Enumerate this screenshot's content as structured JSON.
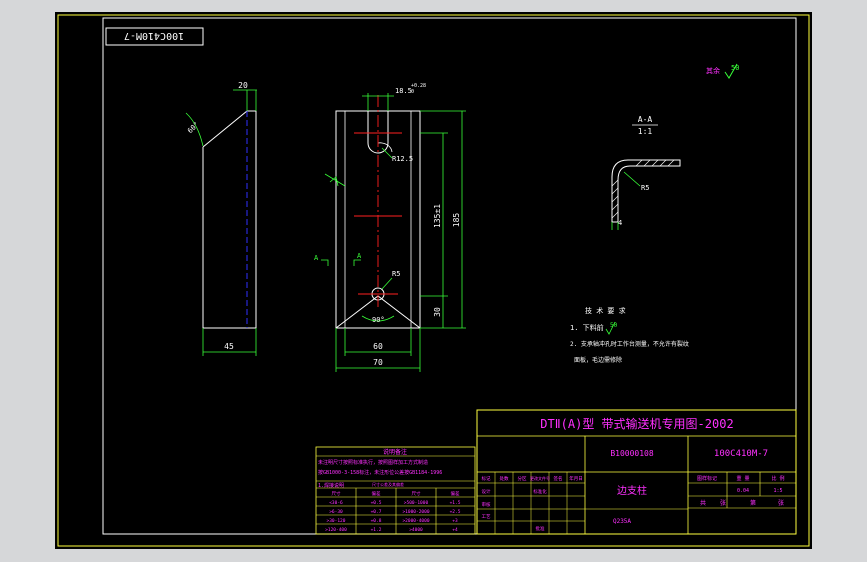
{
  "drawing": {
    "stamp_number": "100C410M-7",
    "roughness_note": "其余",
    "roughness_value": "50",
    "section_label": "A-A",
    "section_ratio": "1:1",
    "section_radius": "R5",
    "section_thickness": "4",
    "section_mark_left": "A",
    "section_mark_right": "A",
    "dim_top_width": "18.5",
    "dim_top_tol": "+0.28",
    "dim_top_tol_low": "0",
    "dim_side_width": "20",
    "dim_angle_side": "60°",
    "dim_r12": "R12.5",
    "dim_r5": "R5",
    "dim_135": "135±1",
    "dim_185": "185",
    "dim_30": "30",
    "dim_angle_90": "90°",
    "dim_60": "60",
    "dim_70": "70",
    "dim_45": "45",
    "tech_title": "技 术 要 求",
    "tech_line1": "1. 下料前",
    "tech_line1_val": "50",
    "tech_line2": "2. 支承轴冲孔时工作台测量，不允许有裂纹",
    "tech_line3": "面板，毛边需修除"
  },
  "title_block": {
    "main_title": "DTⅡ(A)型  带式输送机专用图-2002",
    "code_left": "B10000108",
    "code_right": "100C410M-7",
    "part_name": "边支柱",
    "material": "Q235A",
    "stage_label": "图样标记",
    "weight_label": "重 量",
    "scale_label": "比 例",
    "weight_val": "0.04",
    "scale_val": "1:5",
    "sheet_label": "共",
    "sheet_of": "张",
    "sheet_no": "第",
    "sheet_no2": "张",
    "rev_headers": [
      "标记",
      "处数",
      "分区",
      "更改文件号",
      "签名",
      "年月日"
    ],
    "design_row": [
      "设计",
      "",
      "",
      "标准化",
      "",
      ""
    ],
    "check_row": [
      "审核",
      "",
      "",
      "",
      "",
      ""
    ],
    "process_row": [
      "工艺",
      "",
      "",
      "批准",
      "",
      ""
    ]
  },
  "notes_table": {
    "title": "说明备注",
    "line1": "未注明尺寸按照标准执行，按照图样加工方式制造",
    "line2": "按GB1000-3-158标注，未注形位公差按GB1184-1996",
    "line3_label": "1.焊接说明",
    "line3_val": "尺寸公差及其偏差",
    "rows": [
      [
        "尺寸",
        "偏差",
        "尺寸",
        "偏差"
      ],
      [
        "<30-6",
        "+0.5",
        ">500-1000",
        "+1.5"
      ],
      [
        ">6-30",
        "+0.7",
        ">1000-2000",
        "+2.5"
      ],
      [
        ">30-120",
        "+0.8",
        ">2000-4000",
        "+3"
      ],
      [
        ">120-400",
        "+1.2",
        ">4000",
        "+4"
      ]
    ]
  },
  "colors": {
    "frame_outer": "#ffff3c",
    "drawing": "#ffffff",
    "dimension": "#38ff38",
    "center": "#ff2020",
    "hidden": "#3030ff",
    "text_mag": "#ff30ff",
    "text_yel": "#ffff40"
  }
}
